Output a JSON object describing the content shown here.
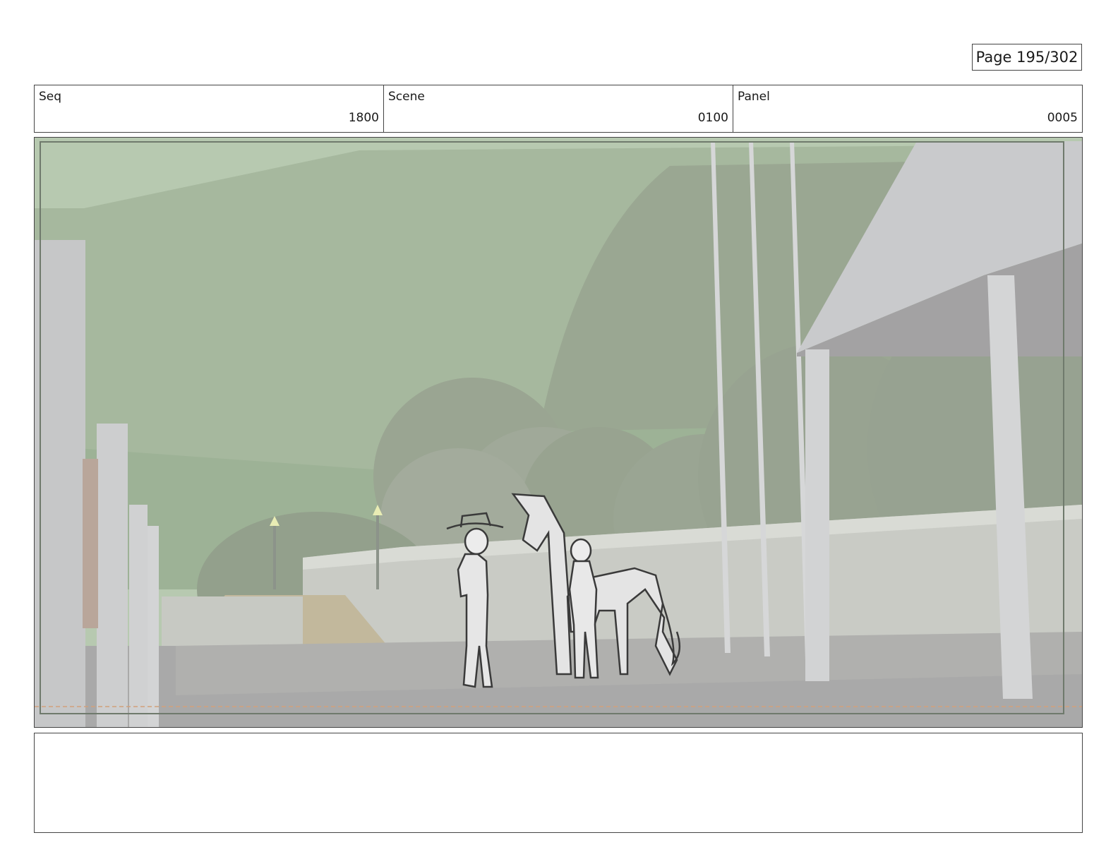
{
  "page": {
    "label": "Page 195/302"
  },
  "header": {
    "seq": {
      "label": "Seq",
      "value": "1800"
    },
    "scene": {
      "label": "Scene",
      "value": "0100"
    },
    "panel": {
      "label": "Panel",
      "value": "0005"
    }
  },
  "panel_image": {
    "description_icon": "storyboard-sketch",
    "colors": {
      "sky": "#b7c9b0",
      "hills": "#a2b49a",
      "dome": "#95a48c",
      "ground": "#a9a9a9",
      "wall": "#c9cbc5",
      "pillar": "#cfd0d0",
      "stairs": "#c2b89c",
      "sketch_line": "#3a3a3a"
    }
  },
  "notes": {
    "text": ""
  }
}
